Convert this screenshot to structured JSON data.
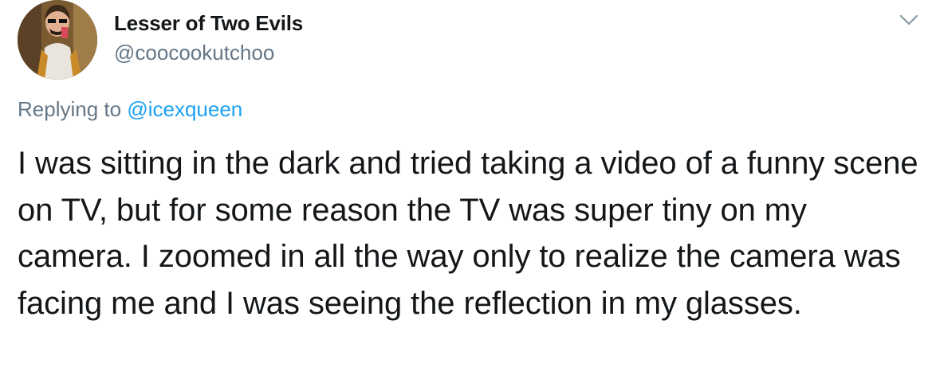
{
  "author": {
    "display_name": "Lesser of Two Evils",
    "handle": "@coocookutchoo"
  },
  "reply": {
    "prefix": "Replying to ",
    "to_handle": "@icexqueen"
  },
  "tweet": {
    "text": "I was sitting in the dark and tried taking a video of a funny scene on TV, but for some reason the TV was super tiny on my camera. I zoomed in all the way only to realize the camera was facing me and I was seeing the reflection in my glasses."
  },
  "icons": {
    "menu": "chevron-down-icon"
  },
  "colors": {
    "text": "#14171a",
    "secondary": "#657786",
    "link": "#1da1f2"
  }
}
